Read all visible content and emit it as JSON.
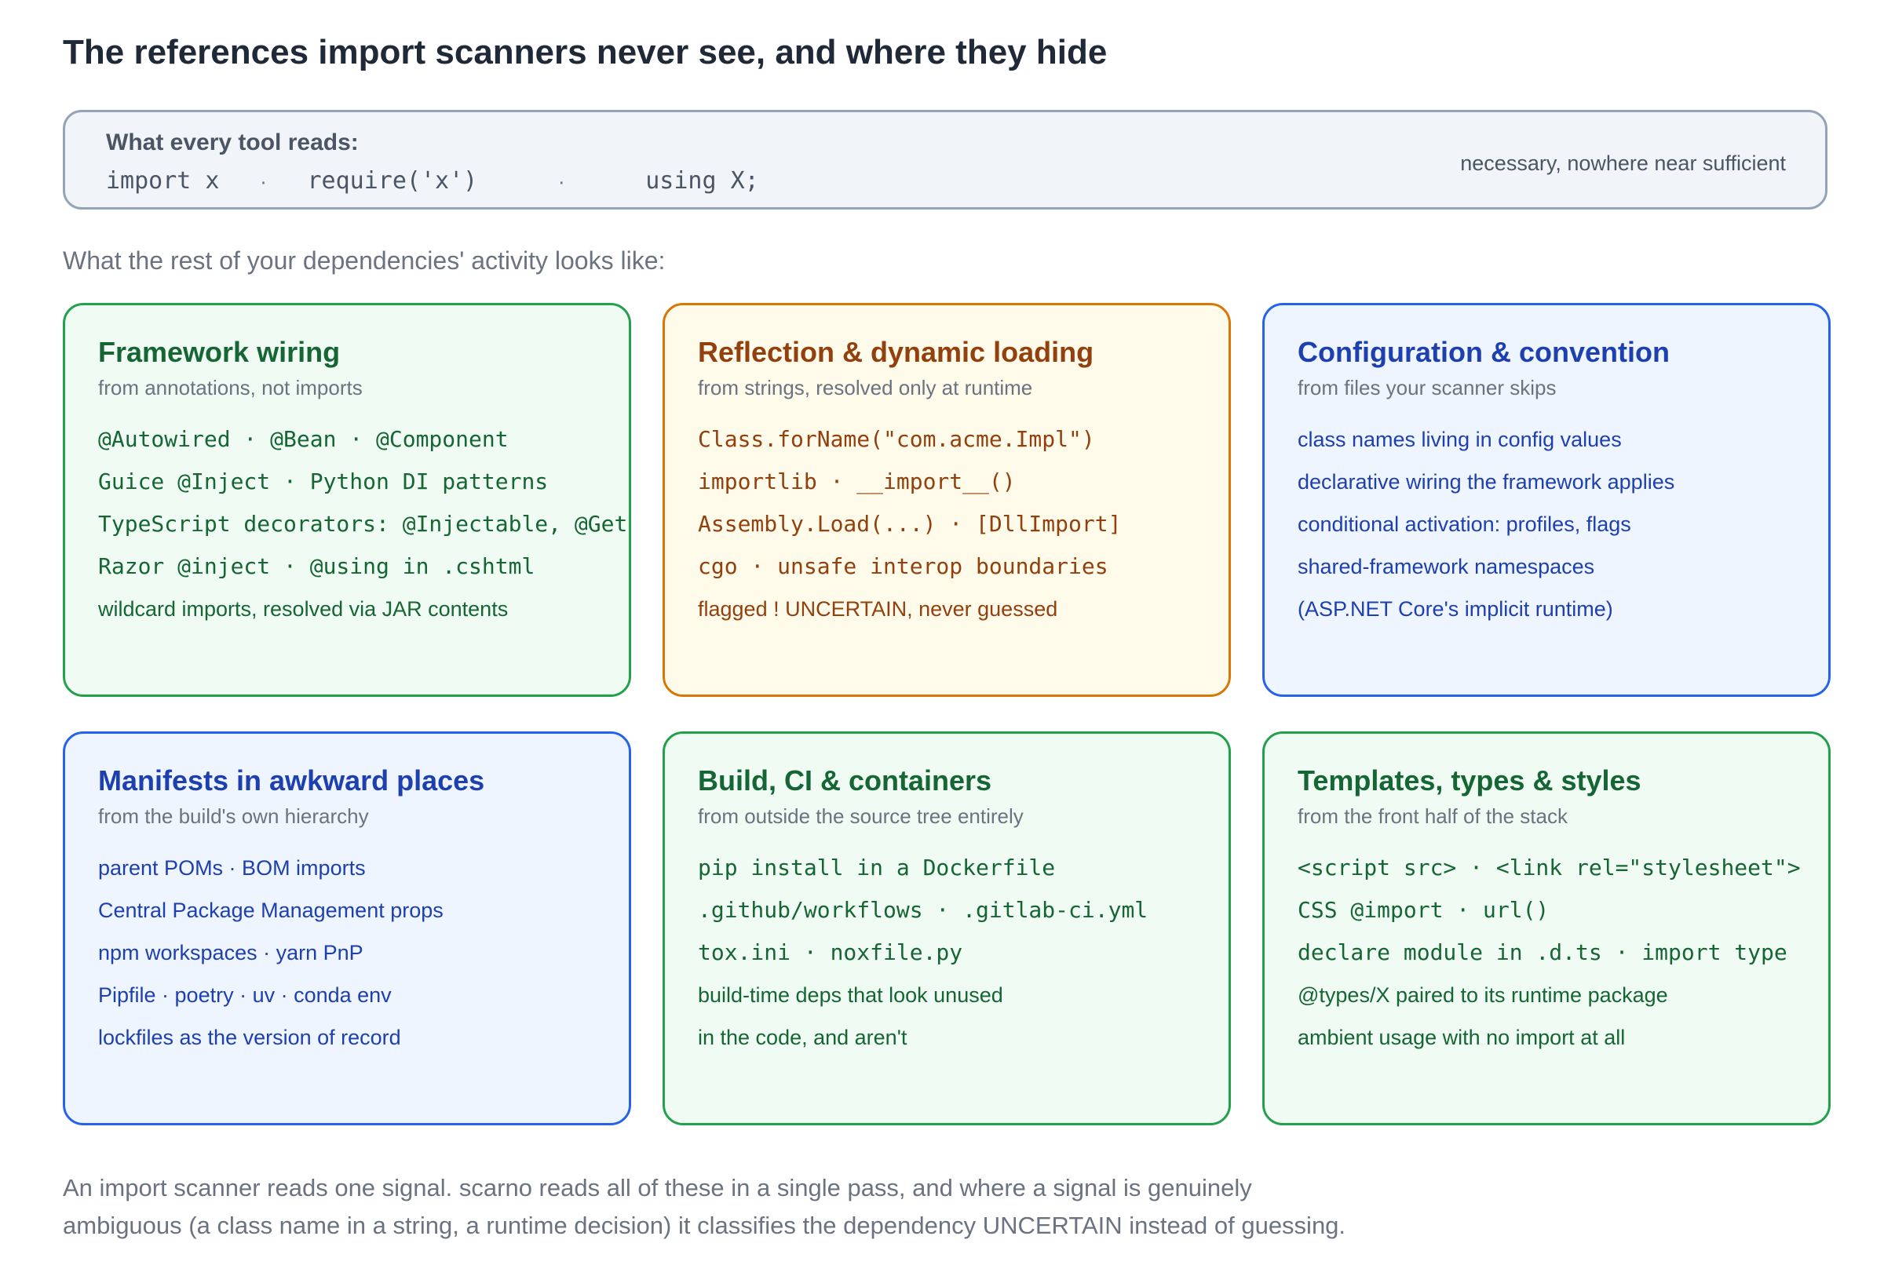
{
  "title": "The references import scanners never see, and where they hide",
  "signal": {
    "label": "What every tool reads:",
    "items": [
      "import x",
      "require('x')",
      "using X;"
    ],
    "separator": "·",
    "note": "necessary, nowhere near sufficient"
  },
  "intro": "What the rest of your dependencies' activity looks like:",
  "colors": {
    "green": "#22a04b",
    "amber": "#d97706",
    "blue": "#2563eb"
  },
  "cards": [
    {
      "title": "Framework wiring",
      "subtitle": "from annotations, not imports",
      "lines": [
        "@Autowired · @Bean · @Component",
        "Guice @Inject · Python DI patterns",
        "TypeScript decorators: @Injectable, @Get",
        "Razor @inject · @using in .cshtml",
        "wildcard imports, resolved via JAR contents"
      ]
    },
    {
      "title": "Reflection & dynamic loading",
      "subtitle": "from strings, resolved only at runtime",
      "lines": [
        "Class.forName(\"com.acme.Impl\")",
        "importlib · __import__()",
        "Assembly.Load(...) · [DllImport]",
        "cgo · unsafe interop boundaries",
        "flagged ! UNCERTAIN, never guessed"
      ]
    },
    {
      "title": "Configuration & convention",
      "subtitle": "from files your scanner skips",
      "lines": [
        "class names living in config values",
        "declarative wiring the framework applies",
        "conditional activation: profiles, flags",
        "shared-framework namespaces",
        "(ASP.NET Core's implicit runtime)"
      ]
    },
    {
      "title": "Manifests in awkward places",
      "subtitle": "from the build's own hierarchy",
      "lines": [
        "parent POMs · BOM imports",
        "Central Package Management props",
        "npm workspaces · yarn PnP",
        "Pipfile · poetry · uv · conda env",
        "lockfiles as the version of record"
      ]
    },
    {
      "title": "Build, CI & containers",
      "subtitle": "from outside the source tree entirely",
      "lines": [
        "pip install in a Dockerfile",
        ".github/workflows · .gitlab-ci.yml",
        "tox.ini · noxfile.py",
        "build-time deps that look unused",
        "in the code, and aren't"
      ]
    },
    {
      "title": "Templates, types & styles",
      "subtitle": "from the front half of the stack",
      "lines": [
        "<script src> · <link rel=\"stylesheet\">",
        "CSS @import · url()",
        "declare module in .d.ts · import type",
        "@types/X paired to its runtime package",
        "ambient usage with no import at all"
      ]
    }
  ],
  "footer": [
    "An import scanner reads one signal. scarno reads all of these in a single pass, and where a signal is genuinely",
    "ambiguous (a class name in a string, a runtime decision) it classifies the dependency UNCERTAIN instead of guessing."
  ]
}
